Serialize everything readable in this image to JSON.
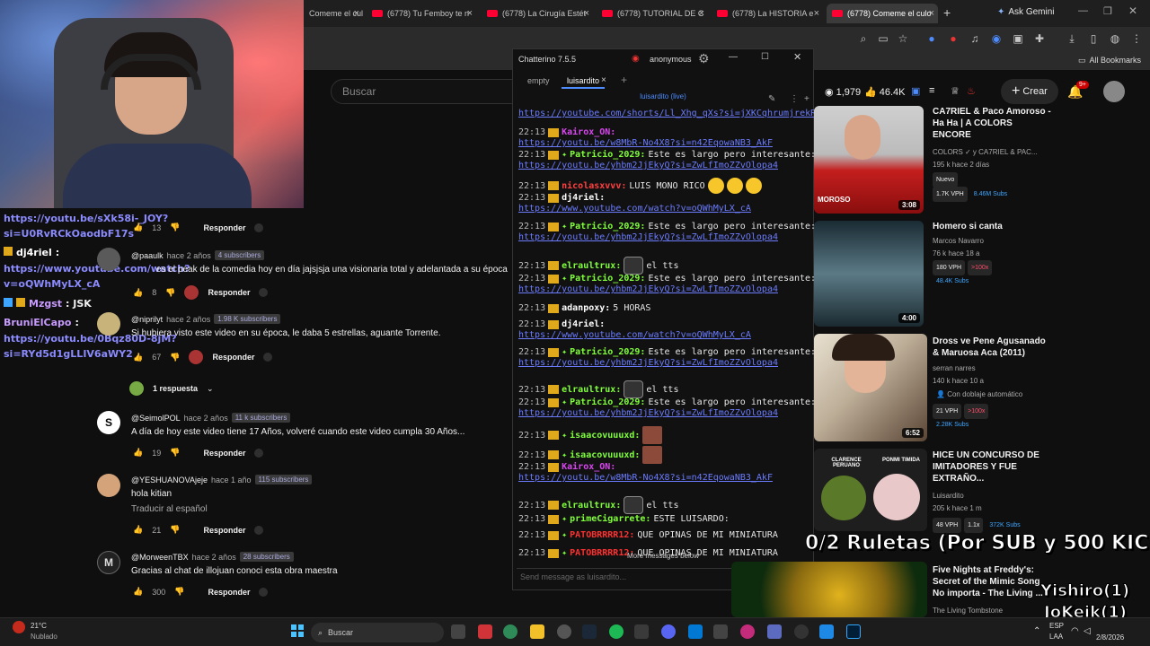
{
  "browser": {
    "tabs": [
      {
        "label": "Comeme el culo"
      },
      {
        "label": "(6778) Tu Femboy te n"
      },
      {
        "label": "(6778) La Cirugía Estét"
      },
      {
        "label": "(6778) TUTORIAL DE C"
      },
      {
        "label": "(6778) La HISTORIA e"
      },
      {
        "label": "(6778) Comeme el culo"
      }
    ],
    "new_tab": "+",
    "ask_gemini": "Ask Gemini",
    "all_bookmarks": "All Bookmarks"
  },
  "youtube": {
    "search_placeholder": "Buscar",
    "viewers": "1,979",
    "likes": "46.4K",
    "create_label": "Crear",
    "notif_count": "9+"
  },
  "overlay_chat": [
    {
      "name": "",
      "text": "https://youtu.be/sXk58i-_JOY?"
    },
    {
      "name": "",
      "text": "si=U0RvRCkOaodbF17s"
    },
    {
      "name": "dj4riel",
      "text": ":"
    },
    {
      "name": "",
      "text": "https://www.youtube.com/watch?"
    },
    {
      "name": "",
      "text": "v=oQWhMyLX_cA"
    },
    {
      "name": "Mzgst",
      "text": ": JSK"
    },
    {
      "name": "BruniElCapo",
      "text": ":"
    },
    {
      "name": "",
      "text": "https://youtu.be/0Bqz80D-8jM?"
    },
    {
      "name": "",
      "text": "si=RYd5d1gLLIV6aWY2"
    }
  ],
  "comments": [
    {
      "likes": "13",
      "reply": "Responder"
    },
    {
      "user": "@paaulk",
      "when": "hace 2 años",
      "badge": "4 subscribers",
      "text": "es el peak de la comedia hoy en día jajsjsja una visionaria total y adelantada a su época",
      "likes": "8",
      "reply": "Responder"
    },
    {
      "user": "@niprilyt",
      "when": "hace 2 años",
      "badge": "1.98 K subscribers",
      "text": "Si hubiera visto este video en su época, le daba 5 estrellas, aguante Torrente.",
      "likes": "67",
      "reply": "Responder",
      "replies": "1 respuesta"
    },
    {
      "user": "@SeimolPOL",
      "when": "hace 2 años",
      "badge": "11 k subscribers",
      "text": "A día de hoy este video tiene 17 Años, volveré cuando este video cumpla 30 Años...",
      "likes": "19",
      "reply": "Responder"
    },
    {
      "user": "@YESHUANOVAjeje",
      "when": "hace 1 año",
      "badge": "115 subscribers",
      "text": "hola kitian",
      "translate": "Traducir al español",
      "likes": "21",
      "reply": "Responder"
    },
    {
      "user": "@MorweenTBX",
      "when": "hace 2 años",
      "badge": "28 subscribers",
      "text": "Gracias al chat de illojuan conoci esta obra maestra",
      "likes": "300",
      "reply": "Responder"
    }
  ],
  "chatterino": {
    "title": "Chatterino 7.5.5",
    "account": "anonymous",
    "tabs": [
      "empty",
      "luisardito"
    ],
    "channel": "luisardito (live)",
    "messages": [
      {
        "ts": "",
        "name": "",
        "text": "",
        "link": "https://youtube.com/shorts/Ll_Xhg_qXs?si=jXKCqhrumjrekRK"
      },
      {
        "ts": "22:13",
        "name": "Kairox_ON:",
        "text": "",
        "link": ""
      },
      {
        "ts": "",
        "name": "",
        "text": "",
        "link": "https://youtu.be/w8MbR-No4X8?si=n42EqowaNB3_AkF"
      },
      {
        "ts": "22:13",
        "name": "Patricio_2029:",
        "text": "Este es largo pero interesante:",
        "link": ""
      },
      {
        "ts": "",
        "name": "",
        "text": "",
        "link": "https://youtu.be/yhbm2JjEkyQ?si=ZwLfImoZZvOlopa4"
      },
      {
        "ts": "22:13",
        "name": "nicolasxvvv:",
        "text": "LUIS MONO RICO",
        "link": ""
      },
      {
        "ts": "22:13",
        "name": "dj4riel:",
        "text": "",
        "link": ""
      },
      {
        "ts": "",
        "name": "",
        "text": "",
        "link": "https://www.youtube.com/watch?v=oQWhMyLX_cA"
      },
      {
        "ts": "22:13",
        "name": "Patricio_2029:",
        "text": "Este es largo pero interesante:",
        "link": ""
      },
      {
        "ts": "",
        "name": "",
        "text": "",
        "link": "https://youtu.be/yhbm2JjEkyQ?si=ZwLfImoZZvOlopa4"
      },
      {
        "ts": "22:13",
        "name": "elraultrux:",
        "text": "el tts",
        "link": ""
      },
      {
        "ts": "22:13",
        "name": "Patricio_2029:",
        "text": "Este es largo pero interesante:",
        "link": ""
      },
      {
        "ts": "",
        "name": "",
        "text": "",
        "link": "https://youtu.be/yhbm2JjEkyQ?si=ZwLfImoZZvOlopa4"
      },
      {
        "ts": "22:13",
        "name": "adanpoxy:",
        "text": "5 HORAS",
        "link": ""
      },
      {
        "ts": "22:13",
        "name": "dj4riel:",
        "text": "",
        "link": ""
      },
      {
        "ts": "",
        "name": "",
        "text": "",
        "link": "https://www.youtube.com/watch?v=oQWhMyLX_cA"
      },
      {
        "ts": "22:13",
        "name": "Patricio_2029:",
        "text": "Este es largo pero interesante:",
        "link": ""
      },
      {
        "ts": "",
        "name": "",
        "text": "",
        "link": "https://youtu.be/yhbm2JjEkyQ?si=ZwLfImoZZvOlopa4"
      },
      {
        "ts": "22:13",
        "name": "elraultrux:",
        "text": "el tts",
        "link": ""
      },
      {
        "ts": "22:13",
        "name": "Patricio_2029:",
        "text": "Este es largo pero interesante:",
        "link": ""
      },
      {
        "ts": "",
        "name": "",
        "text": "",
        "link": "https://youtu.be/yhbm2JjEkyQ?si=ZwLfImoZZvOlopa4"
      },
      {
        "ts": "22:13",
        "name": "isaacovuuuxd:",
        "text": "",
        "link": ""
      },
      {
        "ts": "22:13",
        "name": "isaacovuuuxd:",
        "text": "",
        "link": ""
      },
      {
        "ts": "22:13",
        "name": "Kairox_ON:",
        "text": "",
        "link": ""
      },
      {
        "ts": "",
        "name": "",
        "text": "",
        "link": "https://youtu.be/w8MbR-No4X8?si=n42EqowaNB3_AkF"
      },
      {
        "ts": "22:13",
        "name": "elraultrux:",
        "text": "el tts",
        "link": ""
      },
      {
        "ts": "22:13",
        "name": "primeCigarrete:",
        "text": "ESTE LUISARDO:",
        "link": ""
      },
      {
        "ts": "22:13",
        "name": "PATOBRRRR12:",
        "text": "QUE OPINAS DE MI MINIATURA",
        "link": ""
      },
      {
        "ts": "22:13",
        "name": "PATOBRRRR12:",
        "text": "QUE OPINAS DE MI MINIATURA",
        "link": ""
      }
    ],
    "more_messages": "More messages below",
    "input_placeholder": "Send message as luisardito..."
  },
  "sidebar": [
    {
      "title1": "CA7RIEL & Paco Amoroso -",
      "title2": "Ha Ha | A COLORS",
      "title3": "ENCORE",
      "channel": "COLORS ✓ y CA7RIEL & PAC...",
      "meta": "195 k  hace 2 días",
      "badge1": "Nuevo",
      "vph": "1.7K VPH",
      "subs": "8.46M Subs",
      "duration": "3:08",
      "thumb_text": "MOROSO"
    },
    {
      "title1": "Homero si canta",
      "channel": "Marcos Navarro",
      "meta": "76 k  hace 18 a",
      "vph": "180 VPH",
      "mult": ">100x",
      "subs": "48.4K Subs",
      "duration": "4:00"
    },
    {
      "title1": "Dross ve Pene Agusanado",
      "title2": "& Maruosa Aca (2011)",
      "channel": "serran narres",
      "meta": "140 k  hace 10 a",
      "dub": "Con doblaje automático",
      "vph": "21 VPH",
      "mult": ">100x",
      "subs": "2.28K Subs",
      "duration": "6:52"
    },
    {
      "title1": "HICE UN CONCURSO DE",
      "title2": "IMITADORES Y FUE",
      "title3": "EXTRAÑO...",
      "channel": "Luisardito",
      "meta": "205 k  hace 1 m",
      "vph": "48 VPH",
      "mult": "1.1x",
      "subs": "372K Subs",
      "thumb_l": "CLARENCE PERUANO",
      "thumb_r": "PONMI TIMIDA"
    },
    {
      "title1": "Five Nights at Freddy's:",
      "title2": "Secret of the Mimic Song",
      "title3": "No importa - The Living ...",
      "channel": "The Living Tombstone"
    }
  ],
  "overlay": {
    "ruletas": "0/2 Ruletas (Por SUB y 500 KICKS)",
    "line1": "Yishiro(1)",
    "line2": "JoKeik(1)"
  },
  "taskbar": {
    "temp": "21°C",
    "weather": "Nublado",
    "search": "Buscar",
    "lang1": "ESP",
    "lang2": "LAA",
    "date": "2/8/2026"
  }
}
